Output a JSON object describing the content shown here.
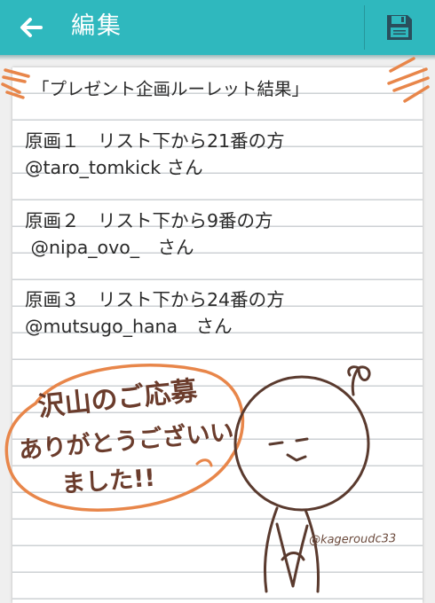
{
  "app_bar": {
    "back_icon": "arrow-left-icon",
    "title": "編集",
    "save_icon": "floppy-disk-icon",
    "color": "#2fb8be"
  },
  "note": {
    "lines": [
      "「プレゼント企画ルーレット結果」",
      "原画１　リスト下から21番の方",
      "@taro_tomkick さん",
      "原画２　リスト下から9番の方",
      " @nipa_ovo_　さん",
      "原画３　リスト下から24番の方",
      "@mutsugo_hana　さん"
    ]
  },
  "illustration": {
    "message": "沢山のご応募ありがとうございました!!",
    "signature": "@kageroudc33",
    "ink_color": "#6b3c2c",
    "accent_color": "#e8864a"
  }
}
